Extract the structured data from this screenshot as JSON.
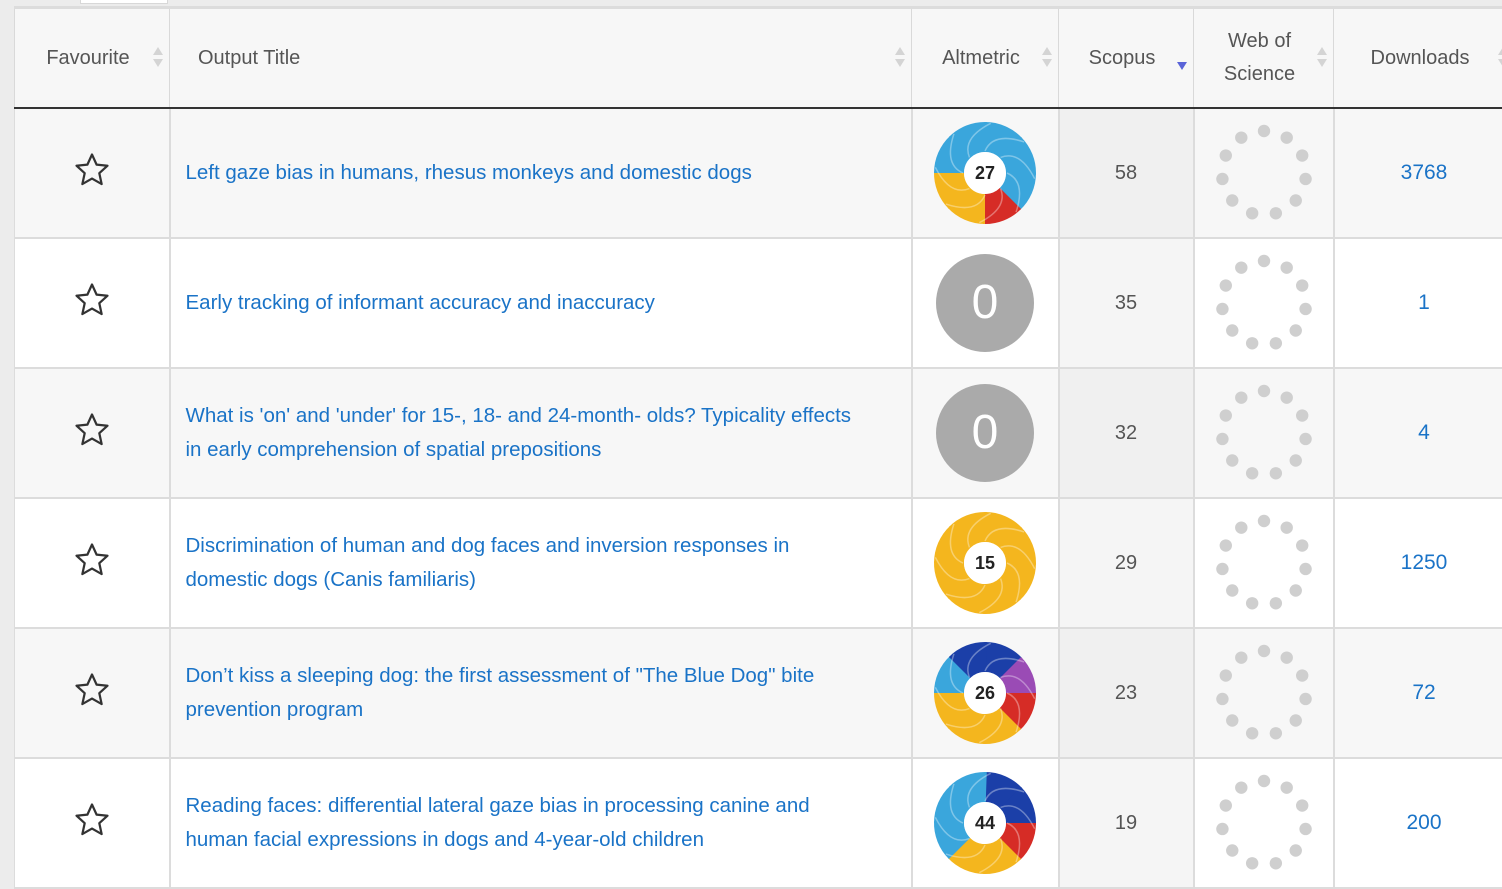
{
  "table": {
    "headers": {
      "favourite": "Favourite",
      "title": "Output Title",
      "altmetric": "Altmetric",
      "scopus": "Scopus",
      "wos_line1": "Web of",
      "wos_line2": "Science",
      "downloads": "Downloads"
    },
    "sort": {
      "column": "Scopus",
      "direction": "descending"
    },
    "rows": [
      {
        "title": "Left gaze bias in humans, rhesus monkeys and domestic dogs",
        "altmetric": "27",
        "altmetric_style": "donut",
        "scopus": "58",
        "downloads": "3768"
      },
      {
        "title": "Early tracking of informant accuracy and inaccuracy",
        "altmetric": "0",
        "altmetric_style": "zero",
        "scopus": "35",
        "downloads": "1"
      },
      {
        "title": "What is 'on' and 'under' for 15-, 18- and 24-month- olds? Typicality effects in early comprehension of spatial prepositions",
        "altmetric": "0",
        "altmetric_style": "zero",
        "scopus": "32",
        "downloads": "4"
      },
      {
        "title": "Discrimination of human and dog faces and inversion responses in domestic dogs (Canis familiaris)",
        "altmetric": "15",
        "altmetric_style": "donut",
        "scopus": "29",
        "downloads": "1250"
      },
      {
        "title": "Don’t kiss a sleeping dog: the first assessment of \"The Blue Dog\" bite prevention program",
        "altmetric": "26",
        "altmetric_style": "donut",
        "scopus": "23",
        "downloads": "72"
      },
      {
        "title": "Reading faces: differential lateral gaze bias in processing canine and human facial expressions in dogs and 4-year-old children",
        "altmetric": "44",
        "altmetric_style": "donut",
        "scopus": "19",
        "downloads": "200"
      }
    ]
  },
  "icons": {
    "favourite": "star-outline-icon",
    "wos_loading": "loading-spinner-icon",
    "sort": "sort-arrows-icon"
  },
  "colors": {
    "link": "#1a73c7",
    "sort_active": "#5a64d8",
    "altmetric_zero": "#aaaaaa",
    "spinner": "#cfcfcf",
    "altmetric_blue": "#3aa6dc",
    "altmetric_navy": "#1b3fa8",
    "altmetric_red": "#d62c26",
    "altmetric_yellow": "#f4b61e",
    "altmetric_purple": "#9a4bb5"
  }
}
